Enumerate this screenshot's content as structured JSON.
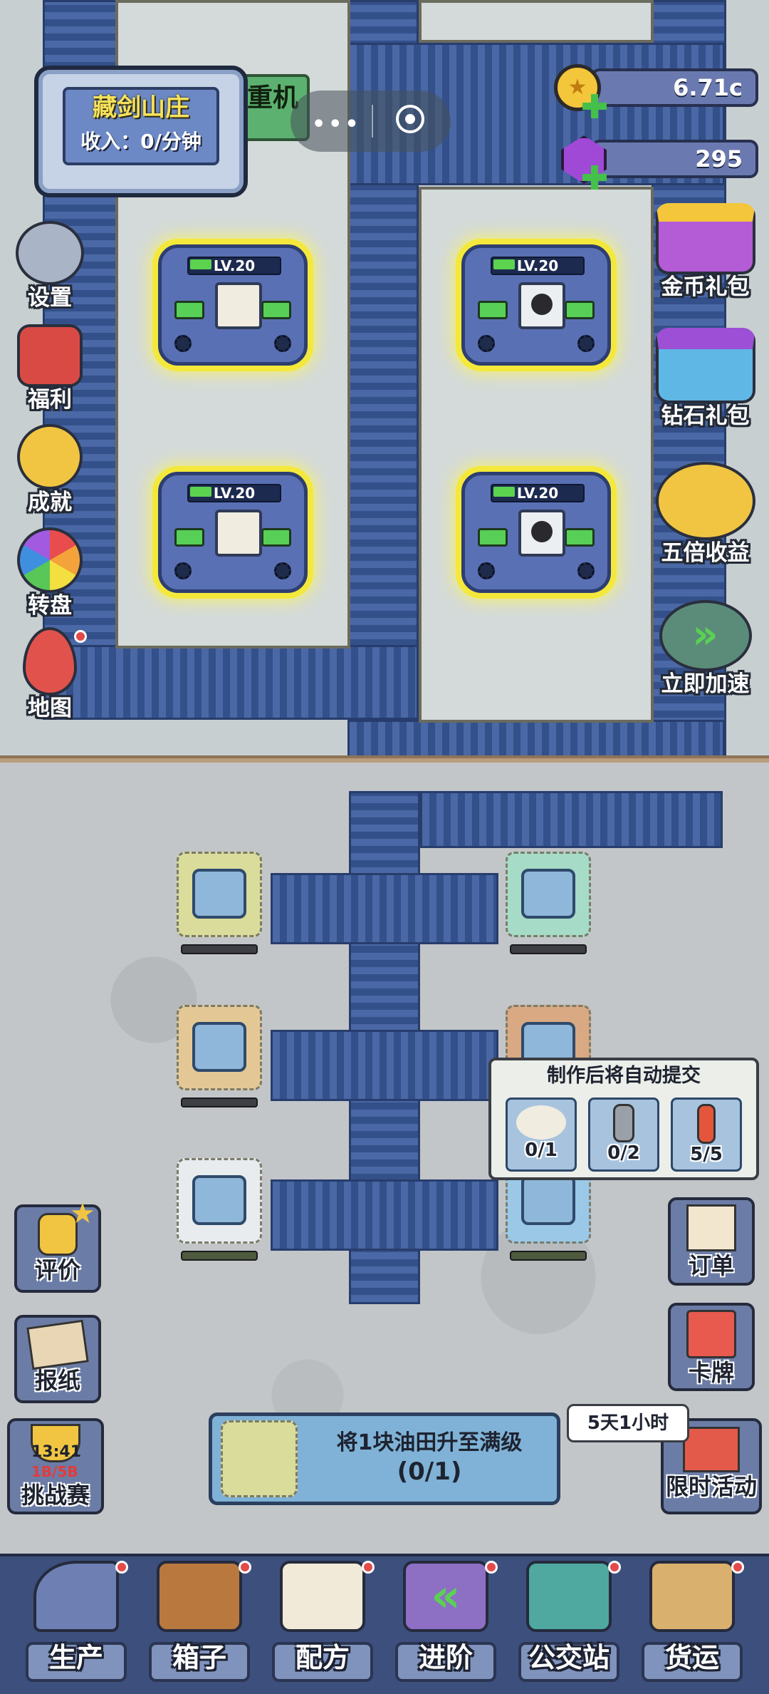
{
  "factory": {
    "name": "藏剑山庄",
    "income_label": "收入：0/分钟",
    "hidden_tab_label": "重机"
  },
  "currency": {
    "coins": "6.71c",
    "gems": "295"
  },
  "left_menu": [
    {
      "label": "设置",
      "icon": "gear-icon"
    },
    {
      "label": "福利",
      "icon": "gift-icon"
    },
    {
      "label": "成就",
      "icon": "star-medal-icon"
    },
    {
      "label": "转盘",
      "icon": "wheel-icon"
    },
    {
      "label": "地图",
      "icon": "map-pin-icon"
    }
  ],
  "right_menu": [
    {
      "label": "金币礼包",
      "icon": "coin-chest-icon"
    },
    {
      "label": "钻石礼包",
      "icon": "gem-box-icon"
    },
    {
      "label": "五倍收益",
      "icon": "coin-stack-icon"
    },
    {
      "label": "立即加速",
      "icon": "fast-forward-icon"
    }
  ],
  "machines": [
    {
      "level": "LV.20",
      "product": "rice"
    },
    {
      "level": "LV.20",
      "product": "black-tank"
    },
    {
      "level": "LV.20",
      "product": "rice"
    },
    {
      "level": "LV.20",
      "product": "black-tank"
    }
  ],
  "order_popup": {
    "title": "制作后将自动提交",
    "items": [
      {
        "name": "rice",
        "count": "0/1"
      },
      {
        "name": "gas-cylinder",
        "count": "0/2"
      },
      {
        "name": "red-cylinder",
        "count": "5/5"
      }
    ]
  },
  "left_bottom_menu": [
    {
      "label": "评价",
      "icon": "thumbs-up-icon"
    },
    {
      "label": "报纸",
      "icon": "newspaper-icon"
    },
    {
      "label": "挑战赛",
      "icon": "trophy-icon",
      "timer": "13:41",
      "score": "1B/5B"
    }
  ],
  "right_bottom_menu": [
    {
      "label": "订单",
      "icon": "clipboard-icon"
    },
    {
      "label": "卡牌",
      "icon": "cards-icon"
    },
    {
      "label": "限时活动",
      "icon": "event-gift-icon",
      "countdown": "5天1小时"
    }
  ],
  "task_banner": {
    "text": "将1块油田升至满级",
    "progress": "(0/1)"
  },
  "bottom_nav": [
    {
      "label": "生产",
      "icon": "robot-arm-icon"
    },
    {
      "label": "箱子",
      "icon": "crate-icon"
    },
    {
      "label": "配方",
      "icon": "recipe-book-icon"
    },
    {
      "label": "进阶",
      "icon": "upgrade-icon"
    },
    {
      "label": "公交站",
      "icon": "bus-stop-icon"
    },
    {
      "label": "货运",
      "icon": "cargo-icon"
    }
  ],
  "colors": {
    "conveyor": "#3e5a93",
    "machine_glow": "#f4e83b",
    "level_bar": "#5bd34f",
    "nav_bg": "#3d4f7c"
  }
}
